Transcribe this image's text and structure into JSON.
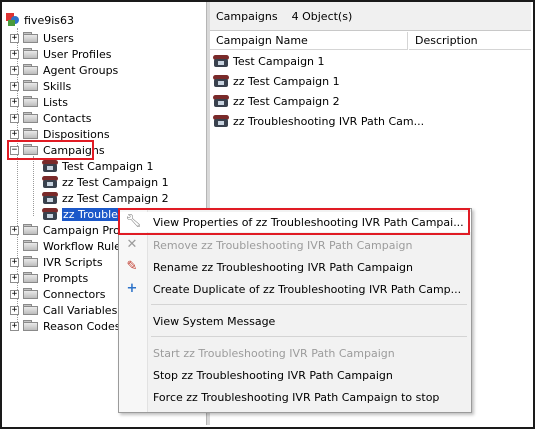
{
  "colors": {
    "accent_red": "#e01b24",
    "selection_blue": "#1c58c9"
  },
  "tree": {
    "root_label": "five9is63",
    "items": [
      {
        "label": "Users",
        "expander": "+"
      },
      {
        "label": "User Profiles",
        "expander": "+"
      },
      {
        "label": "Agent Groups",
        "expander": "+"
      },
      {
        "label": "Skills",
        "expander": "+"
      },
      {
        "label": "Lists",
        "expander": "+"
      },
      {
        "label": "Contacts",
        "expander": "+"
      },
      {
        "label": "Dispositions",
        "expander": "+"
      },
      {
        "label": "Campaigns",
        "expander": "−"
      },
      {
        "label": "Test Campaign 1"
      },
      {
        "label": "zz Test Campaign 1"
      },
      {
        "label": "zz Test Campaign 2"
      },
      {
        "label": "zz Troubles"
      },
      {
        "label": "Campaign Prof",
        "expander": "+"
      },
      {
        "label": "Workflow Rule"
      },
      {
        "label": "IVR Scripts",
        "expander": "+"
      },
      {
        "label": "Prompts",
        "expander": "+"
      },
      {
        "label": "Connectors",
        "expander": "+"
      },
      {
        "label": "Call Variables",
        "expander": "+"
      },
      {
        "label": "Reason Codes",
        "expander": "+"
      }
    ]
  },
  "right_pane": {
    "title": "Campaigns",
    "count": "4 Object(s)",
    "columns": [
      "Campaign Name",
      "Description"
    ],
    "rows": [
      "Test Campaign 1",
      "zz Test Campaign 1",
      "zz Test Campaign 2",
      "zz Troubleshooting IVR Path Cam..."
    ]
  },
  "context_menu": {
    "items": [
      {
        "label": "View Properties of zz Troubleshooting IVR Path Campai...",
        "icon": "wrench-icon",
        "disabled": false
      },
      {
        "label": "Remove zz Troubleshooting IVR Path Campaign",
        "icon": "delete-x-icon",
        "disabled": true
      },
      {
        "label": "Rename zz Troubleshooting IVR Path Campaign",
        "icon": "rename-icon",
        "disabled": false
      },
      {
        "label": "Create Duplicate of zz Troubleshooting IVR Path Camp...",
        "icon": "plus-icon",
        "disabled": false
      },
      {
        "label": "View System Message",
        "disabled": false
      },
      {
        "label": "Start zz Troubleshooting IVR Path Campaign",
        "disabled": true
      },
      {
        "label": "Stop zz Troubleshooting IVR Path Campaign",
        "disabled": false
      },
      {
        "label": "Force zz Troubleshooting IVR Path Campaign to stop",
        "disabled": false
      }
    ]
  }
}
